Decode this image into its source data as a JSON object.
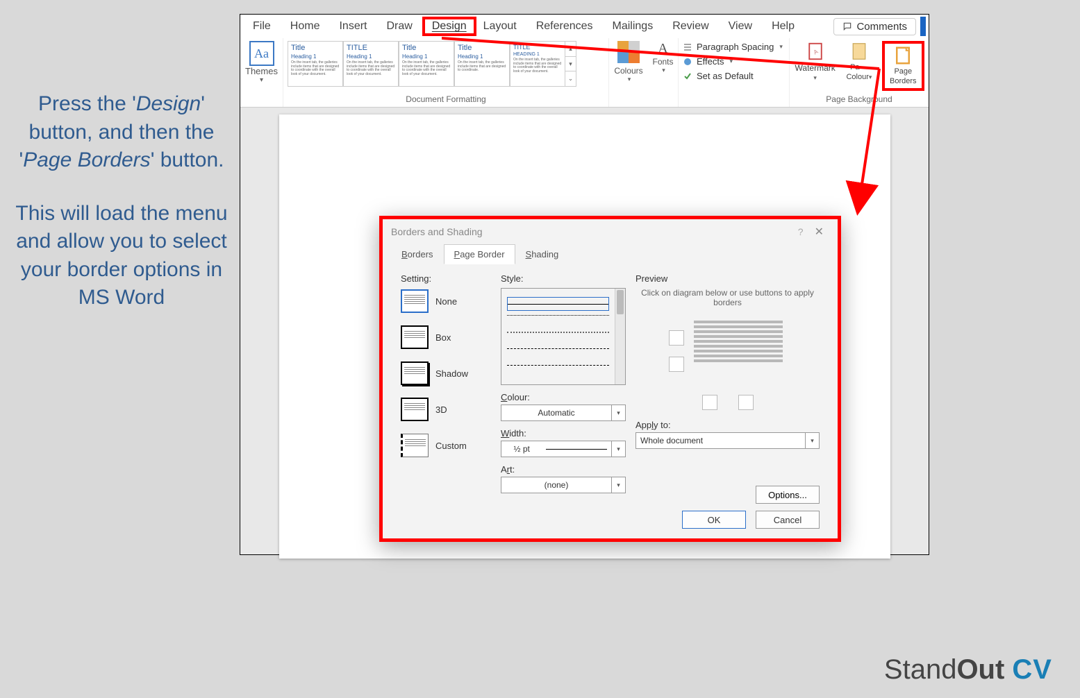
{
  "instruction": {
    "line1_pre": "Press the '",
    "line1_em": "Design",
    "line1_post": "' button, and then the '",
    "line2_em": "Page Borders",
    "line2_post": "' button.",
    "para2": "This will load the menu and allow you to select your border options in MS Word"
  },
  "ribbon": {
    "tabs": [
      "File",
      "Home",
      "Insert",
      "Draw",
      "Design",
      "Layout",
      "References",
      "Mailings",
      "Review",
      "View",
      "Help"
    ],
    "active_tab": "Design",
    "comments": "Comments",
    "groups": {
      "themes": "Themes",
      "doc_formatting": "Document Formatting",
      "colours": "Colours",
      "fonts": "Fonts",
      "paragraph_spacing": "Paragraph Spacing",
      "effects": "Effects",
      "set_default": "Set as Default",
      "page_background": "Page Background",
      "watermark": "Watermark",
      "page_colour": "Page Colour",
      "page_borders": "Page Borders"
    },
    "style_thumbs": [
      {
        "title": "Title",
        "heading": "Heading 1"
      },
      {
        "title": "TITLE",
        "heading": "Heading 1"
      },
      {
        "title": "Title",
        "heading": "Heading 1"
      },
      {
        "title": "Title",
        "heading": "Heading 1"
      },
      {
        "title": "TITLE",
        "heading": "HEADING 1"
      }
    ]
  },
  "dialog": {
    "title": "Borders and Shading",
    "tabs": {
      "borders": "Borders",
      "page_border": "Page Border",
      "shading": "Shading"
    },
    "setting_label": "Setting:",
    "settings": {
      "none": "None",
      "box": "Box",
      "shadow": "Shadow",
      "threed": "3D",
      "custom": "Custom"
    },
    "style_label": "Style:",
    "colour_label": "Colour:",
    "colour_value": "Automatic",
    "width_label": "Width:",
    "width_value": "½ pt",
    "art_label": "Art:",
    "art_value": "(none)",
    "preview_label": "Preview",
    "preview_hint": "Click on diagram below or use buttons to apply borders",
    "apply_label": "Apply to:",
    "apply_value": "Whole document",
    "options": "Options...",
    "ok": "OK",
    "cancel": "Cancel"
  },
  "brand": {
    "standout": "StandOut",
    "cv": "CV"
  }
}
